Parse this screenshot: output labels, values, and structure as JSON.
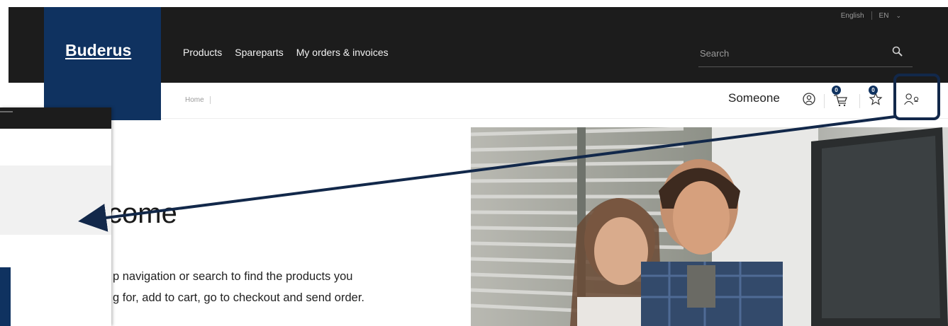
{
  "header": {
    "language_label": "English",
    "language_code": "EN",
    "brand": "Buderus",
    "nav": [
      "Products",
      "Spareparts",
      "My orders & invoices"
    ],
    "search_placeholder": "Search"
  },
  "subheader": {
    "breadcrumb": "Home",
    "user_name": "Someone",
    "cart_count": "0",
    "favorites_count": "0"
  },
  "content": {
    "welcome_fragment": "come",
    "description_line1": "p navigation or search to find the products you",
    "description_line2": "g for, add to cart, go to checkout and send order."
  },
  "colors": {
    "header_bg": "#1c1c1c",
    "brand_blue": "#0f3260",
    "highlight_border": "#12284a"
  },
  "icons": [
    "search-icon",
    "account-icon",
    "cart-icon",
    "favorites-star-icon",
    "user-switch-icon",
    "chevron-down-icon"
  ]
}
